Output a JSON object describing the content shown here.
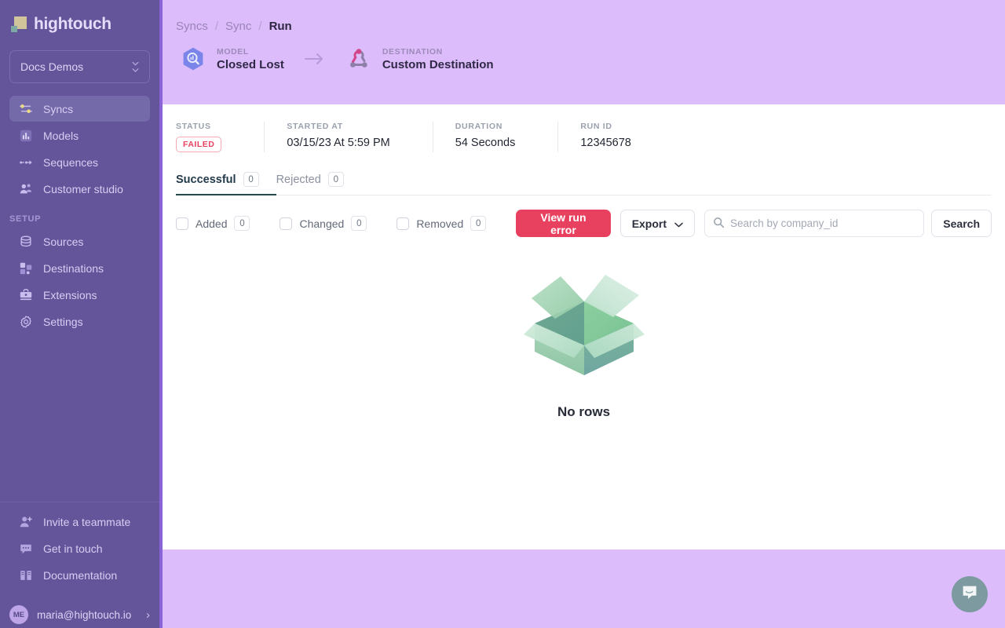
{
  "sidebar": {
    "logo_text": "hightouch",
    "workspace": {
      "name": "Docs Demos"
    },
    "nav_items": [
      {
        "label": "Syncs",
        "icon": "syncs-icon",
        "active": true
      },
      {
        "label": "Models",
        "icon": "models-icon",
        "active": false
      },
      {
        "label": "Sequences",
        "icon": "sequences-icon",
        "active": false
      },
      {
        "label": "Customer studio",
        "icon": "customer-studio-icon",
        "active": false
      }
    ],
    "section_label": "SETUP",
    "setup_items": [
      {
        "label": "Sources",
        "icon": "sources-icon"
      },
      {
        "label": "Destinations",
        "icon": "destinations-icon"
      },
      {
        "label": "Extensions",
        "icon": "extensions-icon"
      },
      {
        "label": "Settings",
        "icon": "settings-icon"
      }
    ],
    "footer_items": [
      {
        "label": "Invite a teammate",
        "icon": "user-plus-icon"
      },
      {
        "label": "Get in touch",
        "icon": "chat-icon"
      },
      {
        "label": "Documentation",
        "icon": "book-icon"
      }
    ],
    "user": {
      "initials": "ME",
      "email": "maria@hightouch.io",
      "chevron": "›"
    }
  },
  "banner": {
    "breadcrumb": [
      {
        "label": "Syncs",
        "current": false
      },
      {
        "label": "Sync",
        "current": false
      },
      {
        "label": "Run",
        "current": true
      }
    ],
    "separator": "/",
    "model": {
      "kicker": "MODEL",
      "name": "Closed Lost",
      "icon": "bigquery-icon"
    },
    "destination": {
      "kicker": "DESTINATION",
      "name": "Custom Destination",
      "icon": "webhook-icon"
    },
    "arrow": "arrow-right-icon"
  },
  "main": {
    "meta": [
      {
        "label": "STATUS",
        "value": "FAILED",
        "is_badge": true
      },
      {
        "label": "STARTED AT",
        "value": "03/15/23 At 5:59 PM",
        "is_badge": false
      },
      {
        "label": "DURATION",
        "value": "54 Seconds",
        "is_badge": false
      },
      {
        "label": "RUN ID",
        "value": "12345678",
        "is_badge": false
      }
    ],
    "tabs": [
      {
        "label": "Successful",
        "count": "0",
        "active": true
      },
      {
        "label": "Rejected",
        "count": "0",
        "active": false
      }
    ],
    "filters": [
      {
        "label": "Added",
        "count": "0",
        "checked": false
      },
      {
        "label": "Changed",
        "count": "0",
        "checked": false
      },
      {
        "label": "Removed",
        "count": "0",
        "checked": false
      }
    ],
    "view_run_error_label": "View run error",
    "export_label": "Export",
    "search": {
      "placeholder": "Search by company_id",
      "value": ""
    },
    "search_button_label": "Search",
    "empty_state": {
      "title": "No rows",
      "illustration": "open-box-icon"
    }
  },
  "chat": {
    "icon": "intercom-chat-icon"
  },
  "colors": {
    "sidebar_bg": "#64559b",
    "banner_bg": "#dcbcfb",
    "accent_danger": "#e8415f",
    "tab_active": "#244c4c",
    "sidebar_edge": "#8a63d8"
  }
}
